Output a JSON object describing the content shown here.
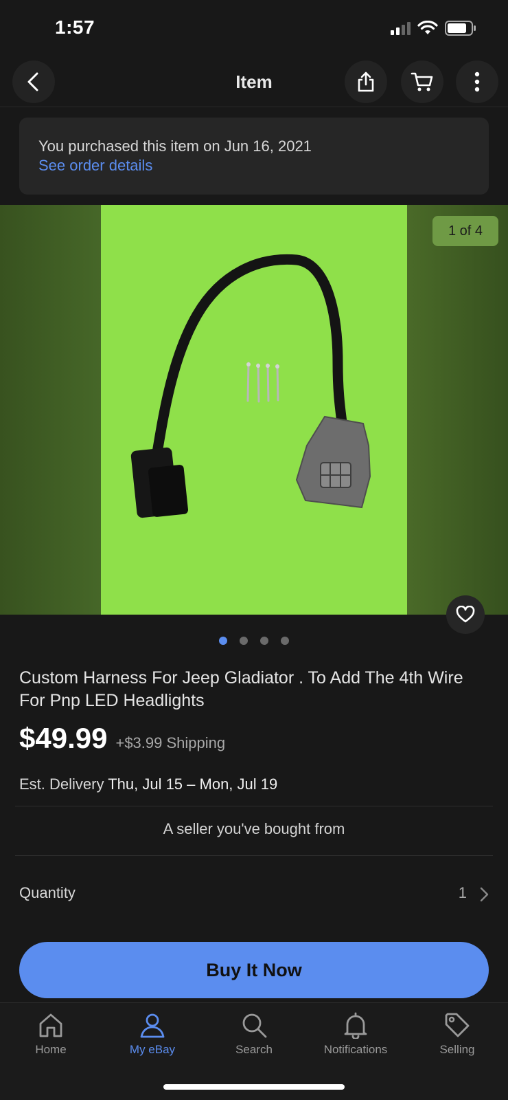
{
  "status_bar": {
    "time": "1:57"
  },
  "nav": {
    "title": "Item",
    "icons": [
      "back-chevron-icon",
      "share-icon",
      "cart-icon",
      "more-vertical-icon"
    ]
  },
  "banner": {
    "text": "You purchased this item on Jun 16, 2021",
    "link": "See order details"
  },
  "gallery": {
    "counter": "1 of 4",
    "total_images": 4,
    "active_index": 0
  },
  "item": {
    "title": "Custom Harness For Jeep  Gladiator . To Add The 4th Wire For Pnp LED Headlights",
    "price": "$49.99",
    "shipping": "+$3.99 Shipping",
    "delivery_label": "Est. Delivery",
    "delivery_dates": "Thu, Jul 15 – Mon, Jul 19",
    "seller_note": "A seller you've bought from"
  },
  "quantity": {
    "label": "Quantity",
    "value": "1"
  },
  "buy_button": {
    "label": "Buy It Now"
  },
  "tab_bar": {
    "tabs": [
      {
        "label": "Home",
        "icon": "home-icon"
      },
      {
        "label": "My eBay",
        "icon": "person-icon"
      },
      {
        "label": "Search",
        "icon": "search-icon"
      },
      {
        "label": "Notifications",
        "icon": "bell-icon"
      },
      {
        "label": "Selling",
        "icon": "tag-icon"
      }
    ],
    "active": "My eBay"
  },
  "colors": {
    "accent": "#5b8def",
    "background": "#181818",
    "photo_bg": "#8fe04a"
  }
}
